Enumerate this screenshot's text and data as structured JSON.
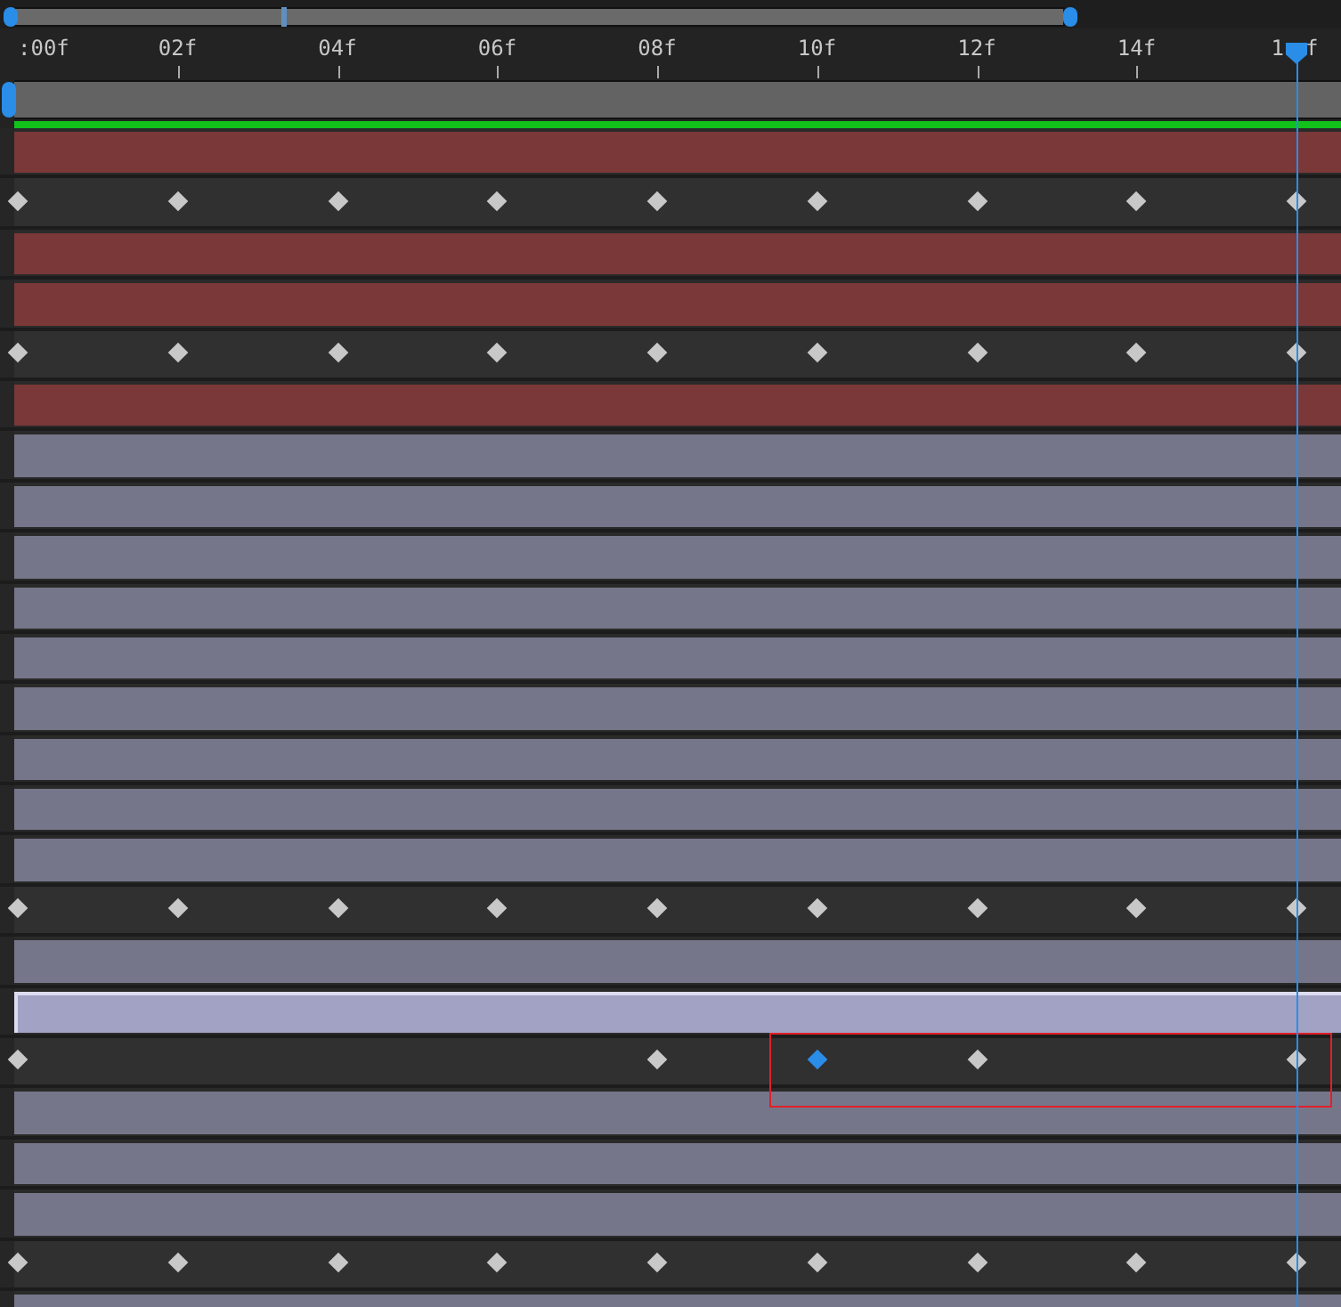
{
  "ruler": {
    "labels": [
      {
        "text": ":00f"
      },
      {
        "text": "02f"
      },
      {
        "text": "04f"
      },
      {
        "text": "06f"
      },
      {
        "text": "08f"
      },
      {
        "text": "10f"
      },
      {
        "text": "12f"
      },
      {
        "text": "14f"
      },
      {
        "text": "1",
        "tail": "f"
      }
    ]
  },
  "playhead": {
    "level": 1
  },
  "rows": [
    {
      "kind": "layer",
      "color": "#7a3838",
      "selected": false
    },
    {
      "kind": "keyframes",
      "keys": [
        {
          "kind": "key",
          "selected": false
        },
        {
          "kind": "key",
          "selected": false
        },
        {
          "kind": "key",
          "selected": false
        },
        {
          "kind": "key",
          "selected": false
        },
        {
          "kind": "key",
          "selected": false
        },
        {
          "kind": "key",
          "selected": false
        },
        {
          "kind": "key",
          "selected": false
        },
        {
          "kind": "key",
          "selected": false
        },
        {
          "kind": "key",
          "selected": false
        }
      ]
    },
    {
      "kind": "layer",
      "color": "#7a3838",
      "selected": false
    },
    {
      "kind": "layer",
      "color": "#7a3838",
      "selected": false
    },
    {
      "kind": "keyframes",
      "keys": [
        {
          "kind": "key",
          "selected": false
        },
        {
          "kind": "key",
          "selected": false
        },
        {
          "kind": "key",
          "selected": false
        },
        {
          "kind": "key",
          "selected": false
        },
        {
          "kind": "key",
          "selected": false
        },
        {
          "kind": "key",
          "selected": false
        },
        {
          "kind": "key",
          "selected": false
        },
        {
          "kind": "key",
          "selected": false
        },
        {
          "kind": "key",
          "selected": false
        }
      ]
    },
    {
      "kind": "layer",
      "color": "#7a3838",
      "selected": false
    },
    {
      "kind": "layer",
      "color": "#76768a",
      "selected": false
    },
    {
      "kind": "layer",
      "color": "#76768a",
      "selected": false
    },
    {
      "kind": "layer",
      "color": "#76768a",
      "selected": false
    },
    {
      "kind": "layer",
      "color": "#76768a",
      "selected": false
    },
    {
      "kind": "layer",
      "color": "#76768a",
      "selected": false
    },
    {
      "kind": "layer",
      "color": "#76768a",
      "selected": false
    },
    {
      "kind": "layer",
      "color": "#76768a",
      "selected": false
    },
    {
      "kind": "layer",
      "color": "#76768a",
      "selected": false
    },
    {
      "kind": "layer",
      "color": "#76768a",
      "selected": false
    },
    {
      "kind": "keyframes",
      "keys": [
        {
          "kind": "key",
          "selected": false
        },
        {
          "kind": "key",
          "selected": false
        },
        {
          "kind": "key",
          "selected": false
        },
        {
          "kind": "key",
          "selected": false
        },
        {
          "kind": "key",
          "selected": false
        },
        {
          "kind": "key",
          "selected": false
        },
        {
          "kind": "key",
          "selected": false
        },
        {
          "kind": "key",
          "selected": false
        },
        {
          "kind": "key",
          "selected": false
        }
      ]
    },
    {
      "kind": "layer",
      "color": "#76768a",
      "selected": false
    },
    {
      "kind": "layer",
      "color": "#a2a2c4",
      "selected": true
    },
    {
      "kind": "keyframes",
      "highlight": true,
      "keys": [
        {
          "kind": "key",
          "selected": false
        },
        {
          "kind": "empty"
        },
        {
          "kind": "empty"
        },
        {
          "kind": "empty"
        },
        {
          "kind": "key",
          "selected": false
        },
        {
          "kind": "key",
          "selected": true
        },
        {
          "kind": "key",
          "selected": false
        },
        {
          "kind": "empty"
        },
        {
          "kind": "key",
          "selected": false
        }
      ]
    },
    {
      "kind": "layer",
      "color": "#76768a",
      "selected": false
    },
    {
      "kind": "layer",
      "color": "#76768a",
      "selected": false
    },
    {
      "kind": "layer",
      "color": "#76768a",
      "selected": false
    },
    {
      "kind": "keyframes",
      "keys": [
        {
          "kind": "key",
          "selected": false
        },
        {
          "kind": "key",
          "selected": false
        },
        {
          "kind": "key",
          "selected": false
        },
        {
          "kind": "key",
          "selected": false
        },
        {
          "kind": "key",
          "selected": false
        },
        {
          "kind": "key",
          "selected": false
        },
        {
          "kind": "key",
          "selected": false
        },
        {
          "kind": "key",
          "selected": false
        },
        {
          "kind": "key",
          "selected": false
        }
      ]
    },
    {
      "kind": "layer",
      "color": "#76768a",
      "selected": false
    }
  ]
}
